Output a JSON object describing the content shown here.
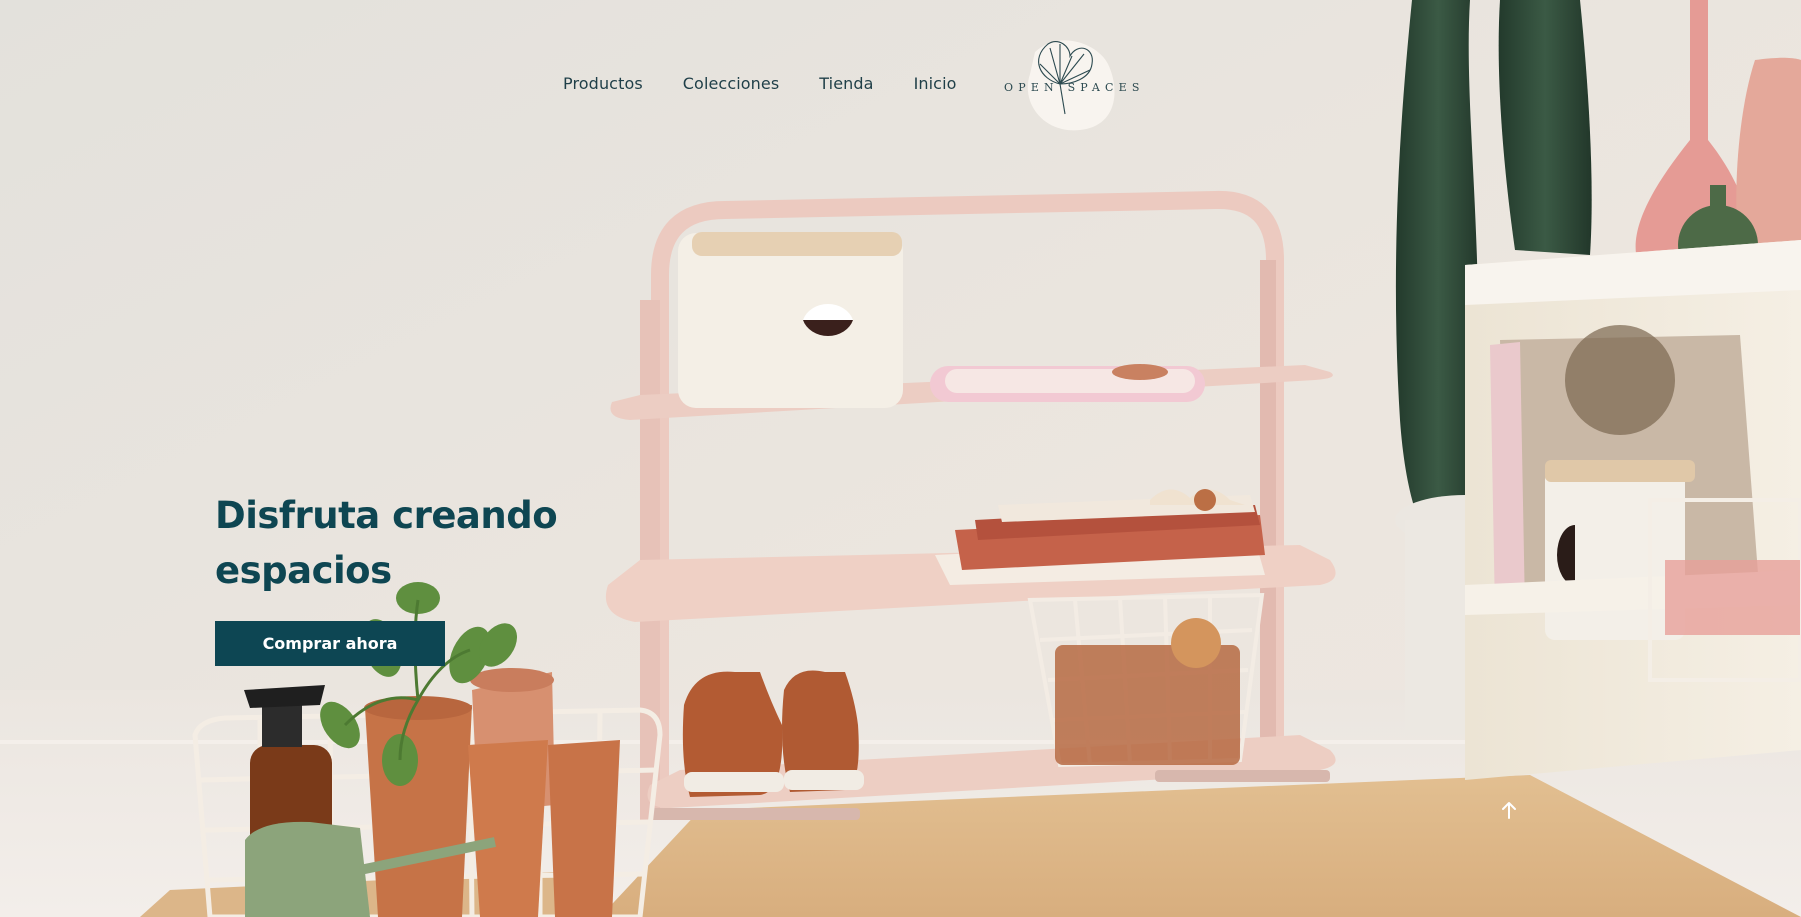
{
  "nav": {
    "items": [
      {
        "label": "Productos"
      },
      {
        "label": "Colecciones"
      },
      {
        "label": "Tienda"
      },
      {
        "label": "Inicio"
      }
    ]
  },
  "logo": {
    "text": "OPEN SPACES",
    "icon": "ginkgo-leaf-icon"
  },
  "hero": {
    "headline": "Disfruta creando espacios",
    "cta_label": "Comprar ahora"
  },
  "scroll_top": {
    "icon": "arrow-up-icon"
  },
  "colors": {
    "accent": "#0d4653",
    "nav_text": "#1f3f48",
    "background": "#e7e3dd"
  }
}
